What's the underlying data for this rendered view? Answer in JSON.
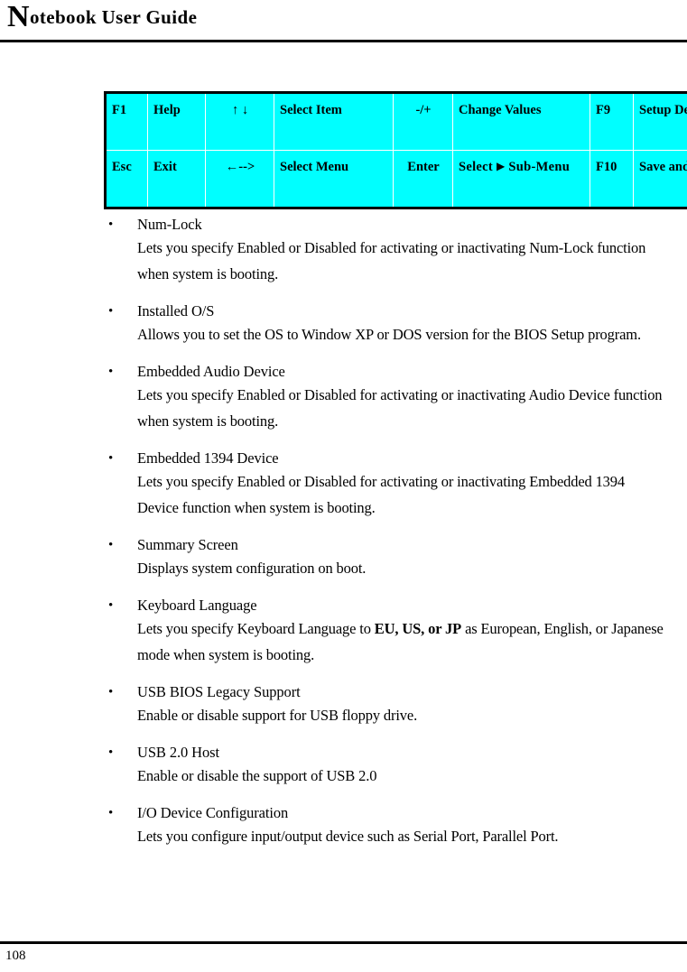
{
  "header": {
    "title_dropcap": "N",
    "title_rest": "otebook User Guide"
  },
  "bios_key_table": {
    "rows": [
      {
        "key": "F1",
        "action": "Help",
        "arrows": "↑ ↓",
        "arrow_action": "Select Item",
        "modifier": "-/+",
        "modifier_action": "Change Values",
        "fkey": "F9",
        "fkey_action": "Setup Defaults"
      },
      {
        "key": "Esc",
        "action": "Exit",
        "arrows": "←-->",
        "arrow_action": "Select Menu",
        "modifier": "Enter",
        "modifier_action_prefix": "Select ",
        "modifier_action_glyph": "▶",
        "modifier_action_suffix": " Sub-Menu",
        "fkey": "F10",
        "fkey_action": "Save and Exit"
      }
    ],
    "background_color": "#00FFFF",
    "border_color": "#000000",
    "grid_color": "#FFFFFF"
  },
  "settings": {
    "bullet_glyph": "•",
    "items": [
      {
        "title": "Num-Lock",
        "description": "Lets you specify Enabled or Disabled for activating or inactivating Num-Lock function when system is booting."
      },
      {
        "title": "Installed O/S",
        "description": "Allows you to set the OS to Window XP or DOS version for the BIOS Setup program."
      },
      {
        "title": "Embedded Audio Device",
        "description": "Lets you specify Enabled or Disabled for activating or inactivating Audio Device function when system is booting."
      },
      {
        "title": "Embedded 1394 Device",
        "description": "Lets you specify Enabled or Disabled for activating or inactivating Embedded 1394  Device function when system is booting."
      },
      {
        "title": "Summary Screen",
        "description": "Displays system configuration on boot."
      },
      {
        "title": "Keyboard Language",
        "description_before_bold": "Lets you specify Keyboard Language to ",
        "description_bold": "EU, US, or JP",
        "description_after_bold": " as European, English, or Japanese mode when system is booting."
      },
      {
        "title": "USB BIOS Legacy Support",
        "description": "Enable or disable support for USB floppy drive."
      },
      {
        "title": "USB 2.0 Host",
        "description": "Enable or disable the support of USB 2.0"
      },
      {
        "title": "I/O Device Configuration",
        "description": "Lets you configure input/output device such as Serial Port, Parallel Port."
      }
    ]
  },
  "footer": {
    "page_number": "108"
  }
}
